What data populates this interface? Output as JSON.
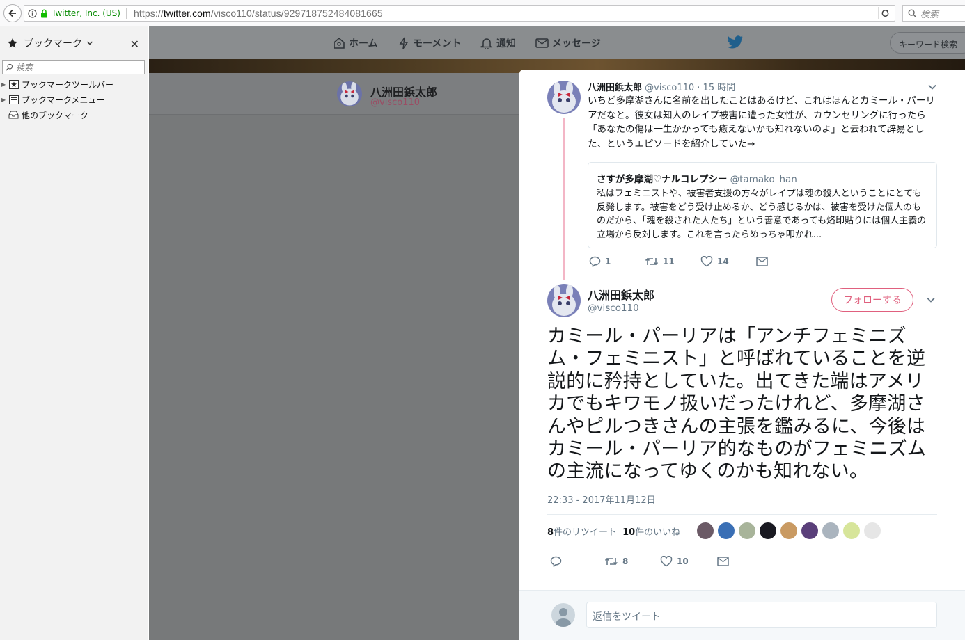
{
  "browser": {
    "site_identity": "Twitter, Inc. (US)",
    "url_prefix": "https://",
    "url_domain": "twitter.com",
    "url_path": "/visco110/status/929718752484081665",
    "search_placeholder": "検索"
  },
  "sidebar": {
    "title": "ブックマーク",
    "search_placeholder": "検索",
    "items": [
      {
        "label": "ブックマークツールバー",
        "icon": "bookmark-toolbar-icon"
      },
      {
        "label": "ブックマークメニュー",
        "icon": "bookmark-menu-icon"
      },
      {
        "label": "他のブックマーク",
        "icon": "other-bookmarks-icon"
      }
    ]
  },
  "twitter_nav": {
    "home": "ホーム",
    "moments": "モーメント",
    "notifications": "通知",
    "messages": "メッセージ",
    "search_placeholder": "キーワード検索"
  },
  "profile": {
    "name": "八洲田鋲太郎",
    "handle": "@visco110"
  },
  "parent_tweet": {
    "name": "八洲田鋲太郎",
    "handle": "@visco110",
    "time": "· 15 時間",
    "text": "いちど多摩湖さんに名前を出したことはあるけど、これはほんとカミール・パーリアだなと。彼女は知人のレイプ被害に遭った女性が、カウンセリングに行ったら「あなたの傷は一生かかっても癒えないかも知れないのよ」と云われて辟易とした、というエピソードを紹介していた→",
    "quote": {
      "name": "さすが多摩湖♡ナルコレプシー",
      "handle": "@tamako_han",
      "text": "私はフェミニストや、被害者支援の方々がレイプは魂の殺人ということにとても反発します。被害をどう受け止めるか、どう感じるかは、被害を受けた個人のものだから、「魂を殺された人たち」という善意であっても烙印貼りには個人主義の立場から反対します。これを言ったらめっちゃ叩かれ..."
    },
    "replies": "1",
    "retweets": "11",
    "likes": "14"
  },
  "main_tweet": {
    "name": "八洲田鋲太郎",
    "handle": "@visco110",
    "follow_label": "フォローする",
    "text": "カミール・パーリアは「アンチフェミニズム・フェミニスト」と呼ばれていることを逆説的に矜持としていた。出てきた端はアメリカでもキワモノ扱いだったけれど、多摩湖さんやピルつきさんの主張を鑑みるに、今後はカミール・パーリア的なものがフェミニズムの主流になってゆくのかも知れない。",
    "timestamp": "22:33 - 2017年11月12日",
    "retweet_count": "8",
    "retweet_label": "件のリツイート",
    "like_count": "10",
    "like_label": "件のいいね",
    "retweets": "8",
    "likes": "10",
    "liker_colors": [
      "#6b5a66",
      "#3a6fb5",
      "#a8b49a",
      "#1a1a22",
      "#c99a62",
      "#5a3f7a",
      "#aab4be",
      "#d7e59a",
      "#e6e6e6"
    ]
  },
  "reply": {
    "placeholder": "返信をツイート"
  },
  "colors": {
    "accent_pink": "#e0607e",
    "thread_line": "#f3b6c6",
    "twitter_blue": "#1da1f2"
  }
}
